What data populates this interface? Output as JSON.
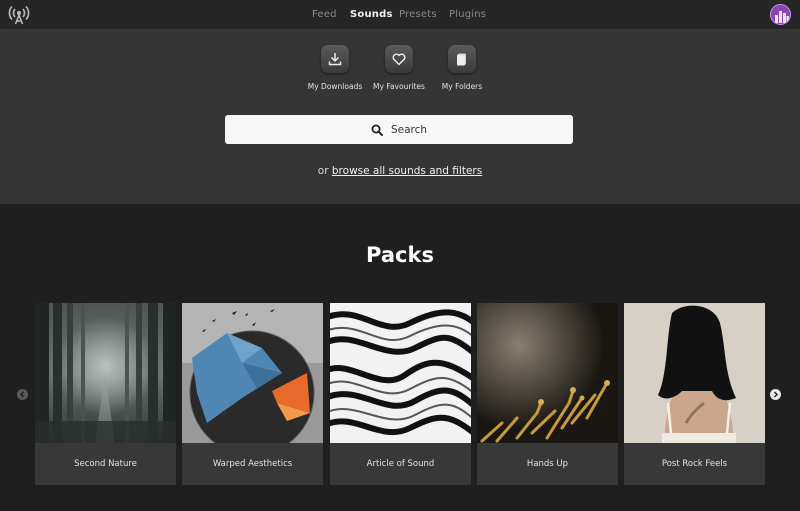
{
  "nav": {
    "items": [
      {
        "label": "Feed"
      },
      {
        "label": "Sounds"
      },
      {
        "label": "Presets"
      },
      {
        "label": "Plugins"
      }
    ],
    "active": "Sounds"
  },
  "quick_links": [
    {
      "label": "My Downloads",
      "icon": "download-icon"
    },
    {
      "label": "My Favourites",
      "icon": "heart-icon"
    },
    {
      "label": "My Folders",
      "icon": "folder-icon"
    }
  ],
  "search": {
    "label": "Search"
  },
  "browse": {
    "prefix": "or",
    "link": "browse all sounds and filters"
  },
  "packs": {
    "title": "Packs",
    "items": [
      {
        "title": "Second Nature"
      },
      {
        "title": "Warped Aesthetics"
      },
      {
        "title": "Article of Sound"
      },
      {
        "title": "Hands Up"
      },
      {
        "title": "Post Rock Feels"
      }
    ]
  },
  "colors": {
    "background": "#1f1f1f",
    "hero": "#353535",
    "topbar": "#262626",
    "card_caption": "#383838"
  }
}
